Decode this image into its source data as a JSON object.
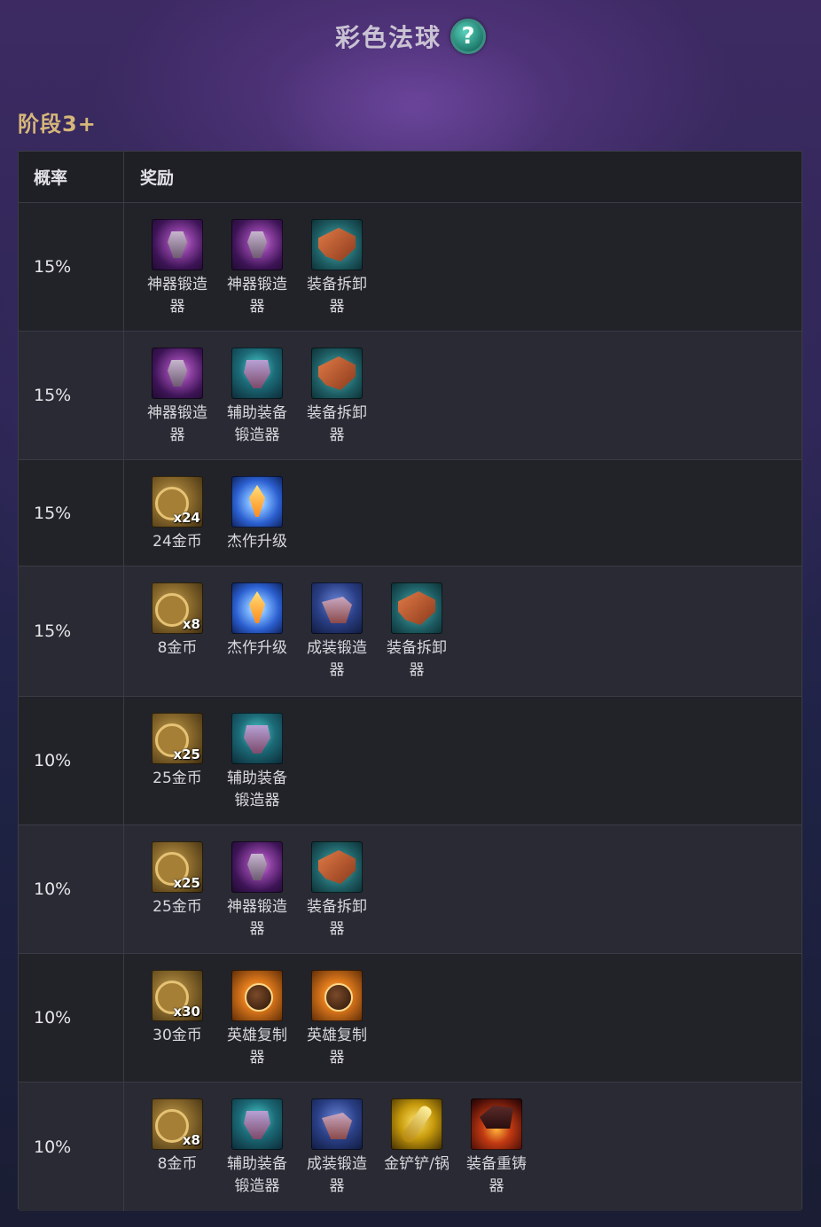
{
  "page": {
    "title": "彩色法球",
    "help_icon": "?",
    "stage_label": "阶段3+"
  },
  "table": {
    "headers": {
      "rate": "概率",
      "reward": "奖励"
    },
    "rows": [
      {
        "rate": "15%",
        "items": [
          {
            "icon": "artifact-anvil-icon",
            "label": "神器锻造\n器"
          },
          {
            "icon": "artifact-anvil-icon",
            "label": "神器锻造\n器"
          },
          {
            "icon": "item-remover-icon",
            "label": "装备拆卸\n器"
          }
        ]
      },
      {
        "rate": "15%",
        "items": [
          {
            "icon": "artifact-anvil-icon",
            "label": "神器锻造\n器"
          },
          {
            "icon": "support-anvil-icon",
            "label": "辅助装备\n锻造器"
          },
          {
            "icon": "item-remover-icon",
            "label": "装备拆卸\n器"
          }
        ]
      },
      {
        "rate": "15%",
        "items": [
          {
            "icon": "gold-coins-icon",
            "qty": "x24",
            "label": "24金币"
          },
          {
            "icon": "masterwork-upgrade-icon",
            "label": "杰作升级"
          }
        ]
      },
      {
        "rate": "15%",
        "items": [
          {
            "icon": "gold-coins-icon",
            "qty": "x8",
            "label": "8金币"
          },
          {
            "icon": "masterwork-upgrade-icon",
            "label": "杰作升级"
          },
          {
            "icon": "completed-anvil-icon",
            "label": "成装锻造\n器"
          },
          {
            "icon": "item-remover-icon",
            "label": "装备拆卸\n器"
          }
        ]
      },
      {
        "rate": "10%",
        "items": [
          {
            "icon": "gold-coins-icon",
            "qty": "x25",
            "label": "25金币"
          },
          {
            "icon": "support-anvil-icon",
            "label": "辅助装备\n锻造器"
          }
        ]
      },
      {
        "rate": "10%",
        "items": [
          {
            "icon": "gold-coins-icon",
            "qty": "x25",
            "label": "25金币"
          },
          {
            "icon": "artifact-anvil-icon",
            "label": "神器锻造\n器"
          },
          {
            "icon": "item-remover-icon",
            "label": "装备拆卸\n器"
          }
        ]
      },
      {
        "rate": "10%",
        "items": [
          {
            "icon": "gold-coins-icon",
            "qty": "x30",
            "label": "30金币"
          },
          {
            "icon": "champion-duplicator-icon",
            "label": "英雄复制\n器"
          },
          {
            "icon": "champion-duplicator-icon",
            "label": "英雄复制\n器"
          }
        ]
      },
      {
        "rate": "10%",
        "items": [
          {
            "icon": "gold-coins-icon",
            "qty": "x8",
            "label": "8金币"
          },
          {
            "icon": "support-anvil-icon",
            "label": "辅助装备\n锻造器"
          },
          {
            "icon": "completed-anvil-icon",
            "label": "成装锻造\n器"
          },
          {
            "icon": "golden-spatula-icon",
            "label": "金铲铲/锅"
          },
          {
            "icon": "reforger-icon",
            "label": "装备重铸\n器"
          }
        ]
      }
    ]
  }
}
